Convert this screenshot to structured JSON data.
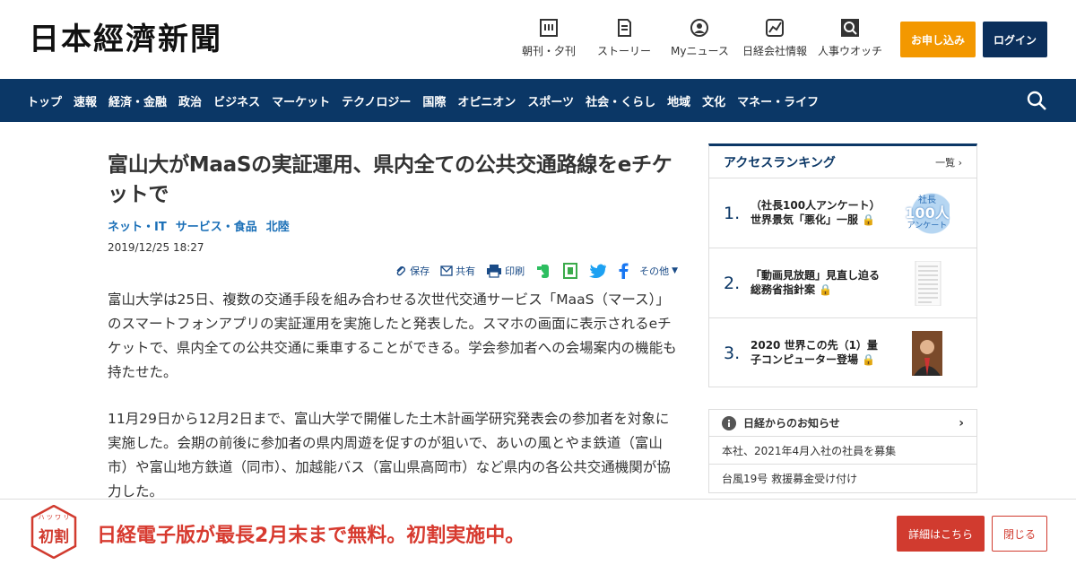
{
  "header": {
    "logo": "日本經濟新聞",
    "nav": [
      {
        "label": "朝刊・夕刊",
        "icon": "newspaper-icon"
      },
      {
        "label": "ストーリー",
        "icon": "story-icon"
      },
      {
        "label": "Myニュース",
        "icon": "user-icon"
      },
      {
        "label": "日経会社情報",
        "icon": "chart-icon"
      },
      {
        "label": "人事ウオッチ",
        "icon": "search-person-icon"
      }
    ],
    "subscribe_label": "お申し込み",
    "login_label": "ログイン"
  },
  "navbar": {
    "items": [
      "トップ",
      "速報",
      "経済・金融",
      "政治",
      "ビジネス",
      "マーケット",
      "テクノロジー",
      "国際",
      "オピニオン",
      "スポーツ",
      "社会・くらし",
      "地域",
      "文化",
      "マネー・ライフ"
    ]
  },
  "article": {
    "title": "富山大がMaaSの実証運用、県内全ての公共交通路線をeチケットで",
    "tags": [
      "ネット・IT",
      "サービス・食品",
      "北陸"
    ],
    "date": "2019/12/25 18:27",
    "share": {
      "save": "保存",
      "share": "共有",
      "print": "印刷",
      "other": "その他"
    },
    "paragraphs": [
      "富山大学は25日、複数の交通手段を組み合わせる次世代交通サービス「MaaS（マース）」のスマートフォンアプリの実証運用を実施したと発表した。スマホの画面に表示されるeチケットで、県内全ての公共交通に乗車することができる。学会参加者への会場案内の機能も持たせた。",
      "11月29日から12月2日まで、富山大学で開催した土木計画学研究発表会の参加者を対象に実施した。会期の前後に参加者の県内周遊を促すのが狙いで、あいの風とやま鉄道（富山市）や富山地方鉄道（同市）、加越能バス（富山県高岡市）など県内の各公共交通機関が協力した。"
    ]
  },
  "ranking": {
    "title": "アクセスランキング",
    "more": "一覧",
    "items": [
      {
        "num": "1.",
        "text": "（社長100人アンケート）世界景気「悪化」一服",
        "thumb_text_top": "社長",
        "thumb_text_mid": "100人",
        "thumb_text_bot": "アンケート"
      },
      {
        "num": "2.",
        "text": "「動画見放題」見直し迫る　総務省指針案"
      },
      {
        "num": "3.",
        "text": "2020 世界この先（1）量子コンピューター登場"
      }
    ]
  },
  "notice": {
    "title": "日経からのお知らせ",
    "items": [
      "本社、2021年4月入社の社員を募集",
      "台風19号 救援募金受け付け"
    ]
  },
  "promo": {
    "badge_top": "ハ ツ ワ リ",
    "badge_main": "初割",
    "text": "日経電子版が最長2月末まで無料。初割実施中。",
    "detail_label": "詳細はこちら",
    "close_label": "閉じる"
  },
  "colors": {
    "navy": "#0b3766",
    "orange": "#f39800",
    "red": "#d13b2f",
    "link": "#1a6fb7"
  }
}
